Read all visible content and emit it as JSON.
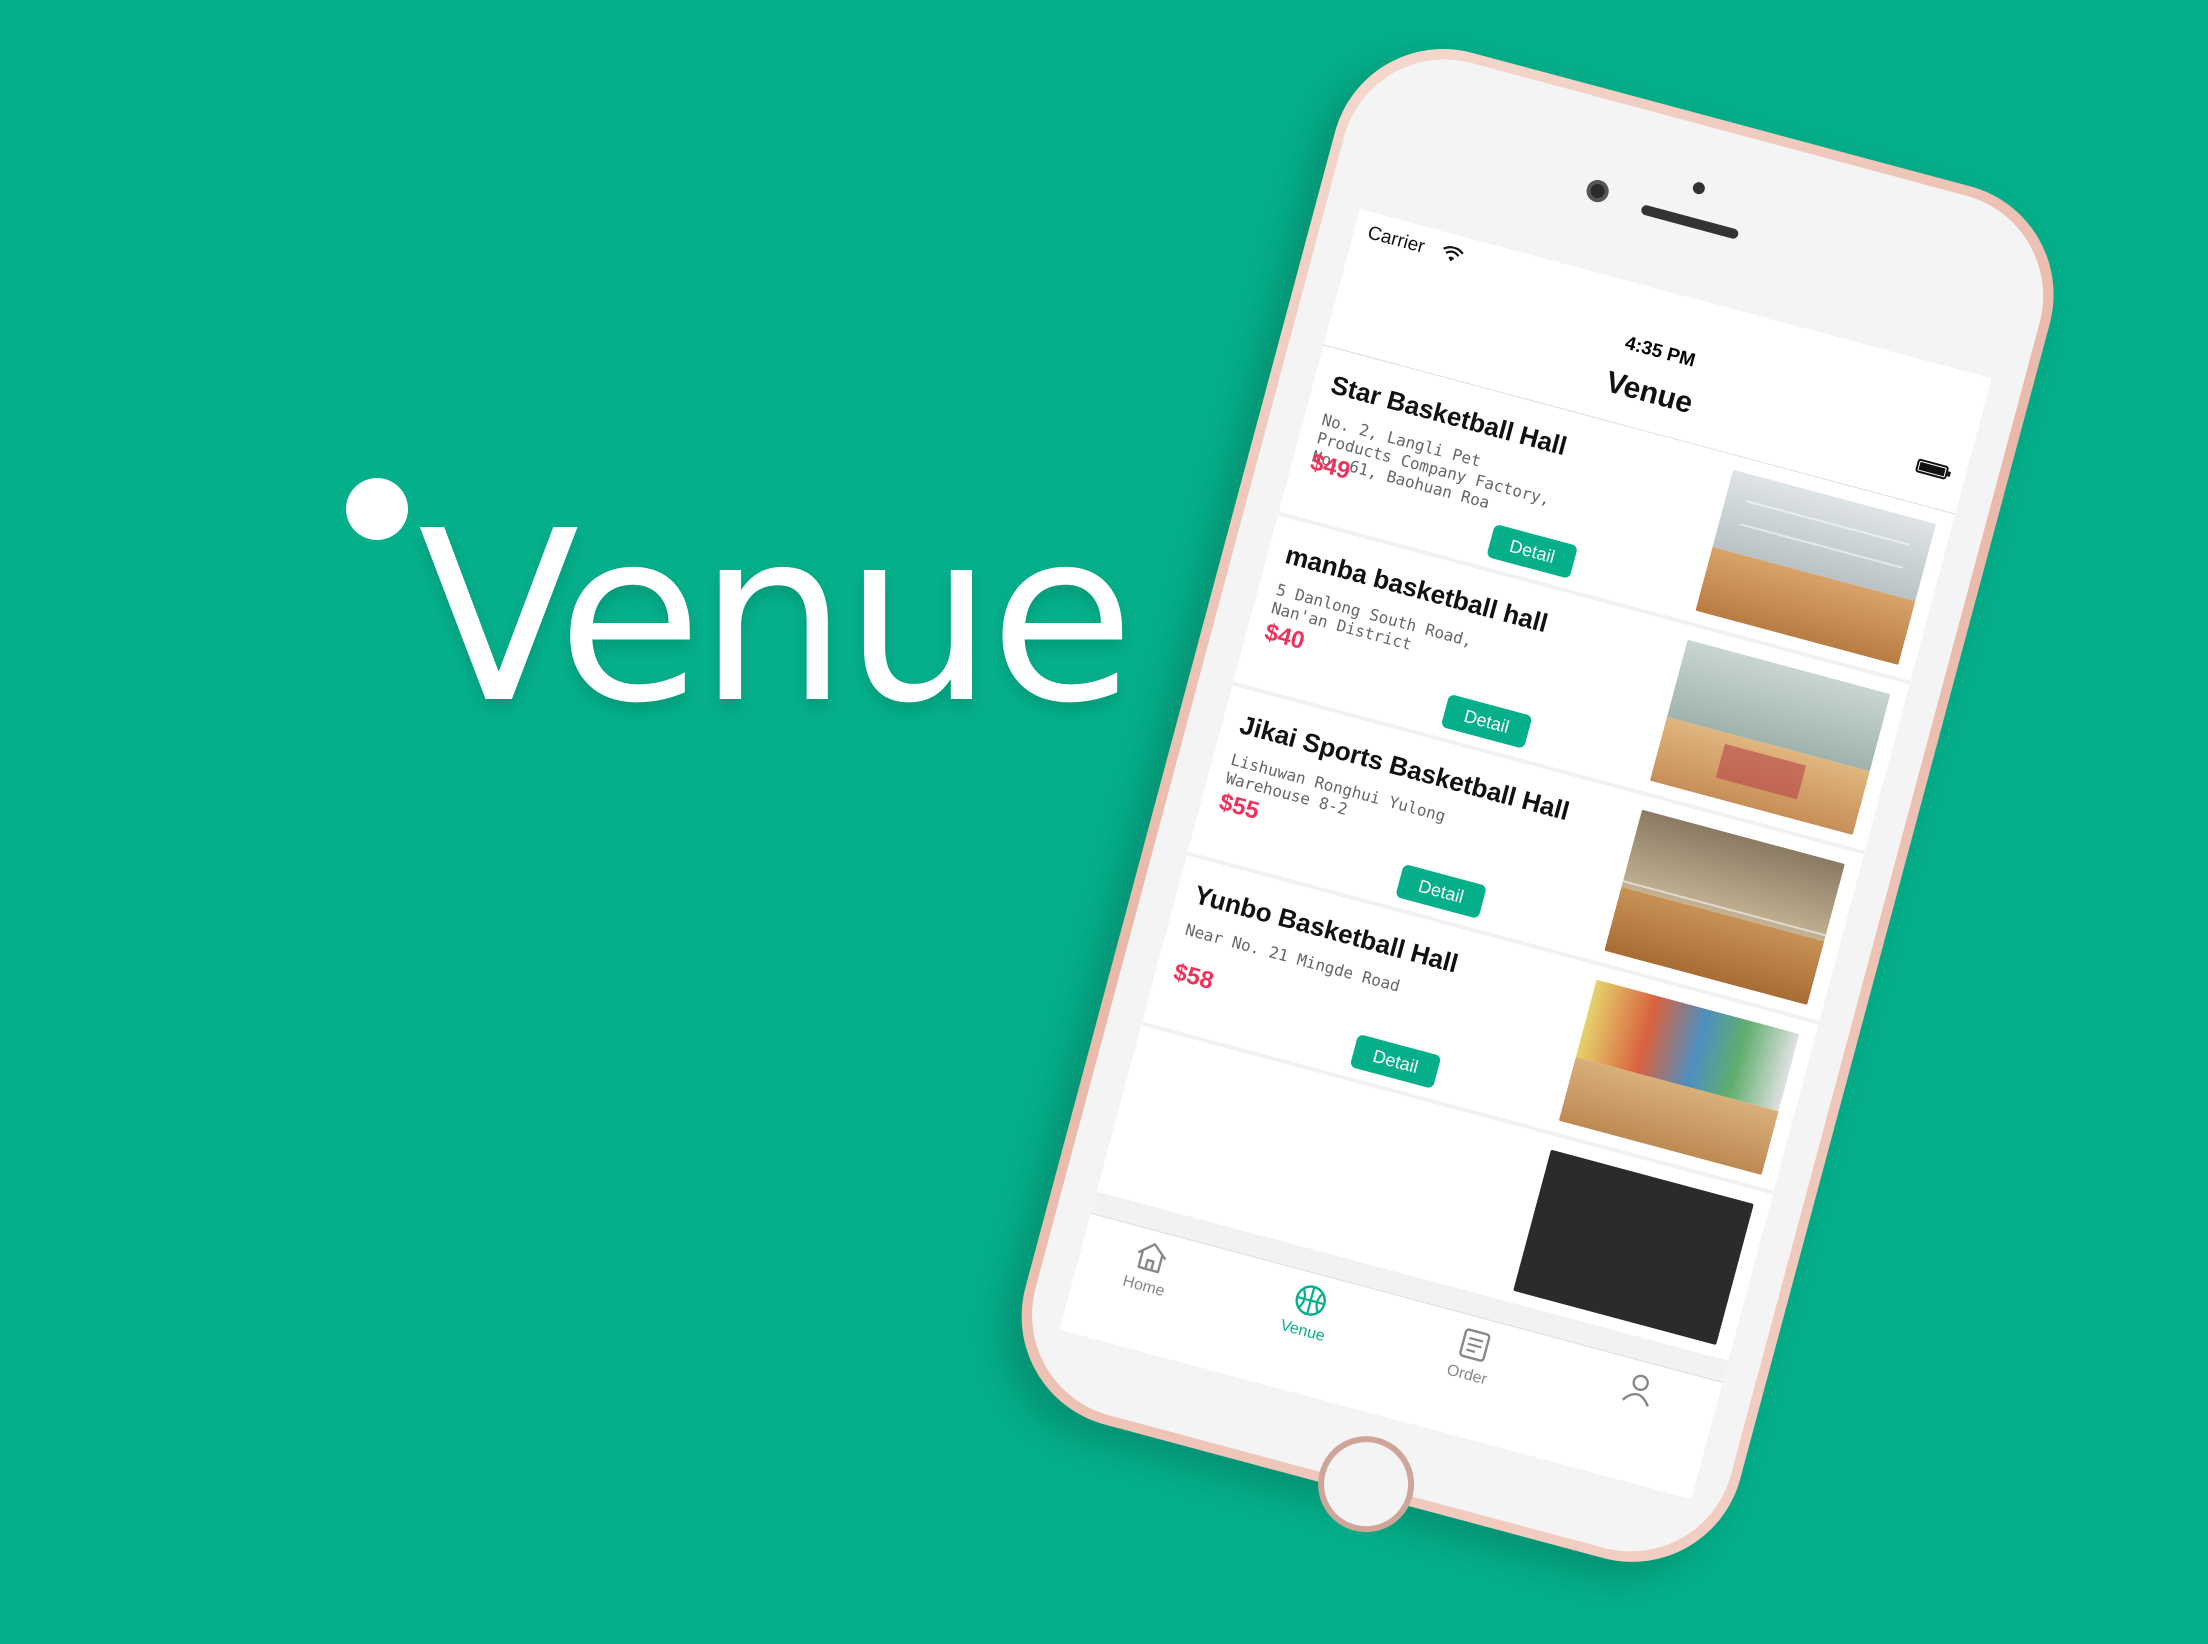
{
  "brand": {
    "word": "Venue"
  },
  "status_bar": {
    "carrier": "Carrier",
    "time": "4:35 PM"
  },
  "nav": {
    "title": "Venue"
  },
  "venues": [
    {
      "name": "Star Basketball Hall",
      "address": "No. 2, Langli Pet Products Company Factory, No. 61, Baohuan Roa",
      "price": "$49",
      "button": "Detail"
    },
    {
      "name": "manba basketball hall",
      "address": "5 Danlong South Road, Nan'an District",
      "price": "$40",
      "button": "Detail"
    },
    {
      "name": "Jikai Sports Basketball Hall",
      "address": "Lishuwan Ronghui Yulong Warehouse 8-2",
      "price": "$55",
      "button": "Detail"
    },
    {
      "name": "Yunbo Basketball Hall",
      "address": "Near No. 21 Mingde Road",
      "price": "$58",
      "button": "Detail"
    }
  ],
  "tabs": [
    {
      "label": "Home",
      "icon": "home-icon",
      "active": false
    },
    {
      "label": "Venue",
      "icon": "basketball-icon",
      "active": true
    },
    {
      "label": "Order",
      "icon": "order-list-icon",
      "active": false
    },
    {
      "label": "",
      "icon": "profile-icon",
      "active": false
    }
  ],
  "colors": {
    "brand_green": "#05af8a",
    "price_red": "#f0325b",
    "phone_frame": "#e9b8a9"
  }
}
